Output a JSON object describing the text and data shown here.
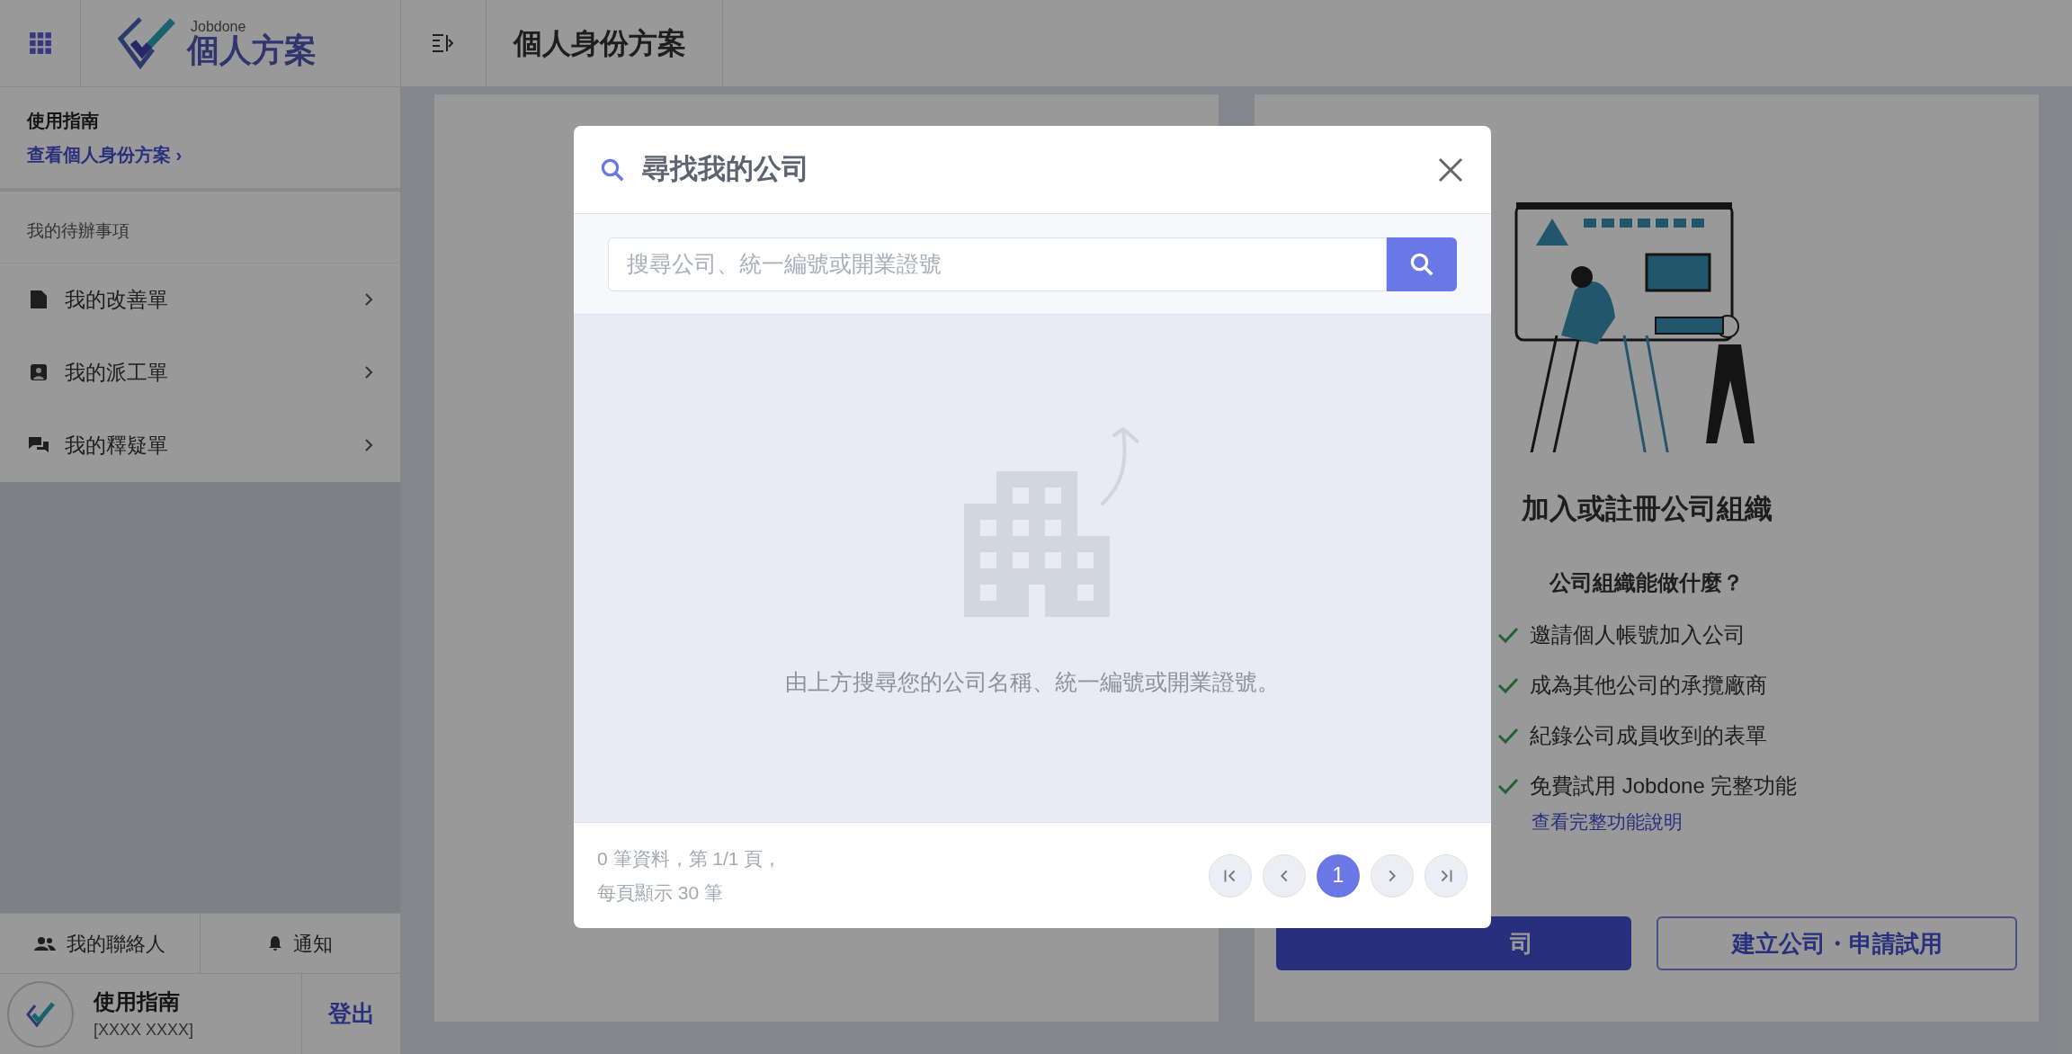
{
  "app_header": {
    "logo_small": "Jobdone",
    "logo_title": "個人方案",
    "page_title": "個人身份方案"
  },
  "sidebar": {
    "guide_title": "使用指南",
    "guide_link": "查看個人身份方案 ›",
    "section_label": "我的待辦事項",
    "items": [
      {
        "kind": "document",
        "label": "我的改善單"
      },
      {
        "kind": "worker",
        "label": "我的派工單"
      },
      {
        "kind": "chat",
        "label": "我的釋疑單"
      }
    ],
    "footer_links": [
      {
        "kind": "contacts",
        "label": "我的聯絡人"
      },
      {
        "kind": "bell",
        "label": "通知"
      }
    ],
    "user": {
      "name": "使用指南",
      "id": "[XXXX XXXX]",
      "logout": "登出"
    }
  },
  "company_card": {
    "title": "加入或註冊公司組織",
    "subtitle": "公司組織能做什麼？",
    "features": [
      "邀請個人帳號加入公司",
      "成為其他公司的承攬廠商",
      "紀錄公司成員收到的表單",
      "免費試用 Jobdone 完整功能"
    ],
    "more_link": "查看完整功能說明",
    "primary_button": "司",
    "secondary_button": "建立公司・申請試用"
  },
  "dialog": {
    "title": "尋找我的公司",
    "search": {
      "placeholder": "搜尋公司、統一編號或開業證號"
    },
    "empty_message": "由上方搜尋您的公司名稱、統一編號或開業證號。",
    "summary_lines": [
      "0 筆資料，第 1/1 頁，",
      "每頁顯示 30 筆"
    ],
    "pagination": [
      {
        "kind": "first"
      },
      {
        "kind": "prev"
      },
      {
        "kind": "page",
        "label": "1",
        "selected": true
      },
      {
        "kind": "next"
      },
      {
        "kind": "last"
      }
    ]
  }
}
